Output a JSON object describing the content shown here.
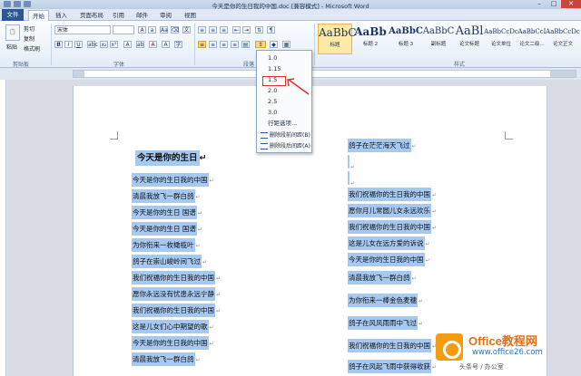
{
  "window": {
    "title": "今天是你的生日我的中国.doc [兼容模式] - Microsoft Word"
  },
  "tabs": [
    "文件",
    "开始",
    "插入",
    "页面布局",
    "引用",
    "邮件",
    "审阅",
    "视图"
  ],
  "clipboard": {
    "paste": "粘贴",
    "cut": "剪切",
    "copy": "复制",
    "format_painter": "格式刷",
    "label": "剪贴板"
  },
  "font": {
    "name": "宋体",
    "size": "",
    "label": "字体"
  },
  "paragraph": {
    "label": "段落"
  },
  "styles": {
    "label": "样式",
    "items": [
      {
        "preview": "AaBbC",
        "name": "标题"
      },
      {
        "preview": "AaBb",
        "name": "标题 2"
      },
      {
        "preview": "AaBbC",
        "name": "标题 3"
      },
      {
        "preview": "AaBbC",
        "name": "副标题"
      },
      {
        "preview": "AaBl",
        "name": "论文标题"
      },
      {
        "preview": "AaBbCcDc",
        "name": "论文单位"
      },
      {
        "preview": "AaBbCcI",
        "name": "论文二级..."
      },
      {
        "preview": "AaBbCcDc",
        "name": "论文正文"
      }
    ]
  },
  "line_spacing_menu": {
    "options": [
      "1.0",
      "1.15",
      "1.5",
      "2.0",
      "2.5",
      "3.0"
    ],
    "selected": "1.5",
    "more": "行距选项...",
    "remove_before": "删除段前间距(B)",
    "remove_after": "删除段后间距(A)"
  },
  "document": {
    "left_title": "今天是你的生日",
    "left_lines": [
      "今天是你的生日我的中国",
      "清晨我放飞一群白鸽",
      "今天是你的生日  国谱",
      "今天是你的生日  国谱",
      "为你衔来一枚橄榄叶",
      "鸽子在崇山峻岭间飞过",
      "我们祝福你的生日我的中国",
      "愿你永远没有忧患永远宁静",
      "我们祝福你的生日我的中国",
      "这是儿女们心中期望的歌",
      "今天是你的生日我的中国",
      "清晨我放飞一群白鸽"
    ],
    "right_lines": [
      "鸽子在茫茫海天飞过",
      "",
      "",
      "我们祝福你的生日我的中国",
      "愿你月儿常圆儿女永远欢乐",
      "我们祝福你的生日我的中国",
      "这是儿女在远方爱的诉说",
      "今天是你的生日我的中国",
      "清晨我放飞一群白鸽",
      "为你衔来一棒金色麦穗",
      "鸽子在风风雨雨中飞过",
      "我们祝福你的生日我的中国",
      "鸽子在风起飞雨中获得收获"
    ]
  },
  "watermark": {
    "title": "Office教程网",
    "url": "www.office26.com",
    "sub": "头条号 / 办公室"
  },
  "colors": {
    "selection": "#a6c9f2",
    "file_tab": "#2b5797",
    "highlight_box": "#e03030"
  }
}
